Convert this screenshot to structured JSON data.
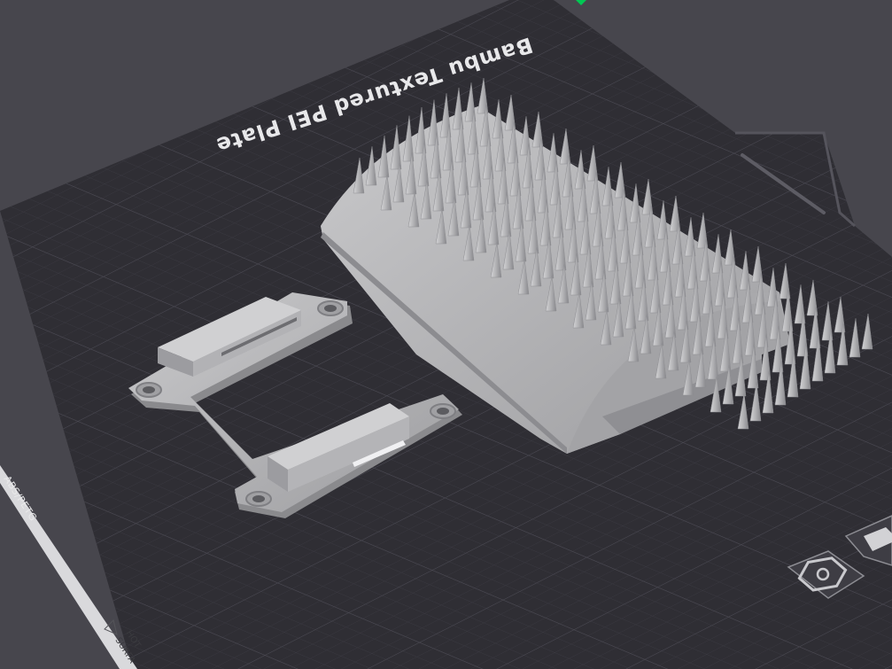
{
  "plate": {
    "title": "Bambu Textured PEI Plate",
    "filament_label": "ABS/PETG",
    "warning_label_line1": "HOT",
    "warning_label_line2": "SURFA"
  },
  "colors": {
    "background": "#47464d",
    "plate_surface": "#2e2d33",
    "plate_edge": "#3a3940",
    "grid_minor": "#3b3a42",
    "grid_major": "#4a4952",
    "model": "#b9b9bb",
    "model_shadow": "#8d8d90",
    "accent": "#00c853",
    "edge_strip": "#e4e4e6"
  },
  "toolbar": {
    "icons": [
      "hexagon-nut-icon",
      "layers-icon"
    ]
  }
}
